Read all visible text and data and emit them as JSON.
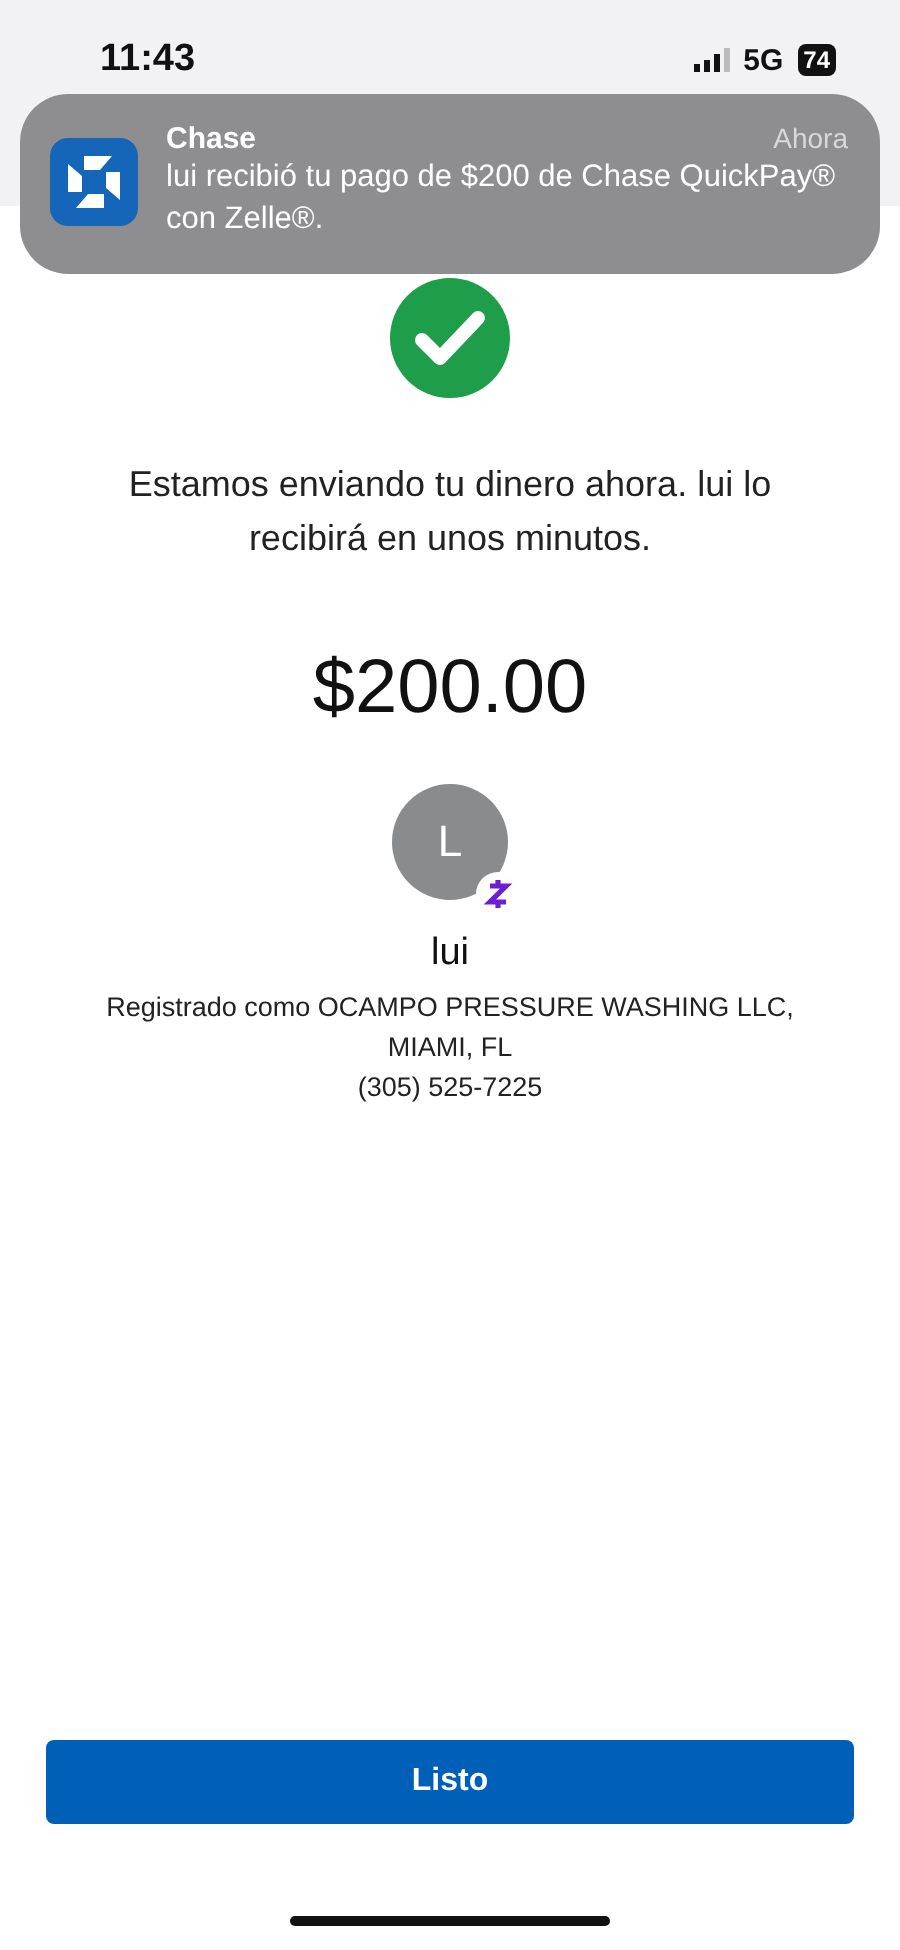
{
  "status_bar": {
    "time": "11:43",
    "network": "5G",
    "battery": "74"
  },
  "notification": {
    "app": "Chase",
    "time": "Ahora",
    "message": "lui recibió tu pago de $200 de Chase QuickPay® con Zelle®."
  },
  "confirmation": {
    "message": "Estamos enviando tu dinero ahora. lui lo recibirá en unos minutos.",
    "amount": "$200.00"
  },
  "recipient": {
    "initial": "L",
    "name": "lui",
    "registered": "Registrado como OCAMPO PRESSURE WASHING LLC, MIAMI, FL",
    "phone": "(305) 525-7225"
  },
  "buttons": [
    {
      "label": "Listo"
    }
  ]
}
